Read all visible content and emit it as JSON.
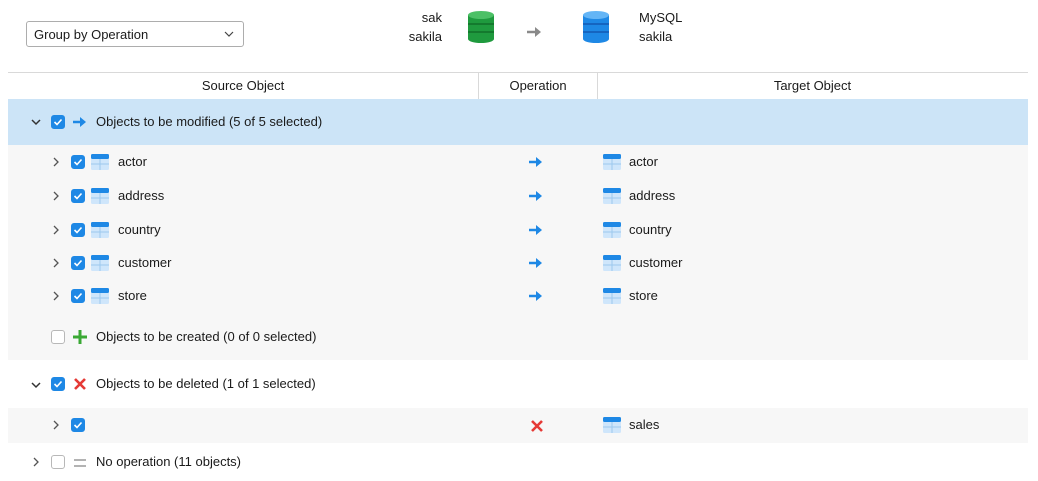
{
  "toolbar": {
    "group_by_select": "Group by Operation"
  },
  "source": {
    "name": "sak",
    "schema": "sakila"
  },
  "target": {
    "name": "MySQL",
    "schema": "sakila"
  },
  "columns": {
    "source": "Source Object",
    "operation": "Operation",
    "target": "Target Object"
  },
  "groups": {
    "modified": {
      "label": "Objects to be modified (5 of 5 selected)",
      "items": [
        {
          "source": "actor",
          "target": "actor"
        },
        {
          "source": "address",
          "target": "address"
        },
        {
          "source": "country",
          "target": "country"
        },
        {
          "source": "customer",
          "target": "customer"
        },
        {
          "source": "store",
          "target": "store"
        }
      ]
    },
    "created": {
      "label": "Objects to be created (0 of 0 selected)"
    },
    "deleted": {
      "label": "Objects to be deleted (1 of 1 selected)",
      "items": [
        {
          "source": "",
          "target": "sales"
        }
      ]
    },
    "no_operation": {
      "label": "No operation (11 objects)"
    }
  },
  "colors": {
    "accent": "#1e88e5",
    "selected_row": "#cce4f7",
    "source_db": "#1f9a3e",
    "target_db": "#1e88e5",
    "delete": "#e53935",
    "create": "#3aa834"
  },
  "icons": [
    "chevron-down-icon",
    "chevron-right-icon",
    "arrow-right-icon",
    "plus-icon",
    "delete-x-icon",
    "equals-icon",
    "table-icon",
    "database-icon"
  ]
}
